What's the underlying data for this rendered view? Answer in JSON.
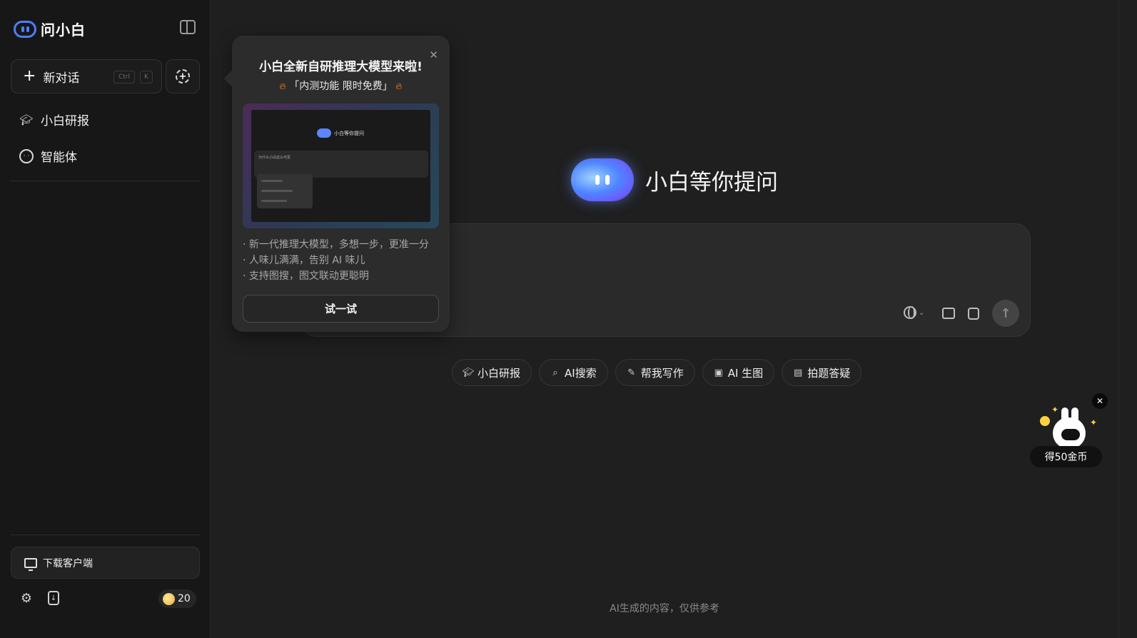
{
  "app": {
    "logo_text": "问小白"
  },
  "sidebar": {
    "new_chat_label": "新对话",
    "shortcut_ctrl": "Ctrl",
    "shortcut_key": "K",
    "items": [
      {
        "label": "小白研报",
        "icon": "graduation-cap-icon"
      },
      {
        "label": "智能体",
        "icon": "bot-face-icon"
      }
    ],
    "download_label": "下载客户端",
    "coins": "20"
  },
  "main": {
    "hero_title": "小白等你提问",
    "input_placeholder": "",
    "chips": [
      {
        "label": "小白研报",
        "icon": "graduation-cap-icon"
      },
      {
        "label": "AI搜索",
        "icon": "search-sparkle-icon"
      },
      {
        "label": "帮我写作",
        "icon": "edit-icon"
      },
      {
        "label": "AI 生图",
        "icon": "image-icon"
      },
      {
        "label": "拍题答疑",
        "icon": "document-icon"
      }
    ],
    "disclaimer": "AI生成的内容，仅供参考"
  },
  "popover": {
    "title": "小白全新自研推理大模型来啦!",
    "subtitle": "「内测功能 限时免费」",
    "preview_hero": "小白等你提问",
    "preview_question": "为什么小白这么可爱",
    "bullets": [
      "· 新一代推理大模型，多想一步，更准一分",
      "· 人味儿满满，告别 AI 味儿",
      "· 支持图搜，图文联动更聪明"
    ],
    "try_label": "试一试"
  },
  "reward": {
    "label": "得50金币"
  },
  "colors": {
    "accent": "#4f7dff",
    "background": "#1f1f1f",
    "sidebar": "#171717"
  }
}
